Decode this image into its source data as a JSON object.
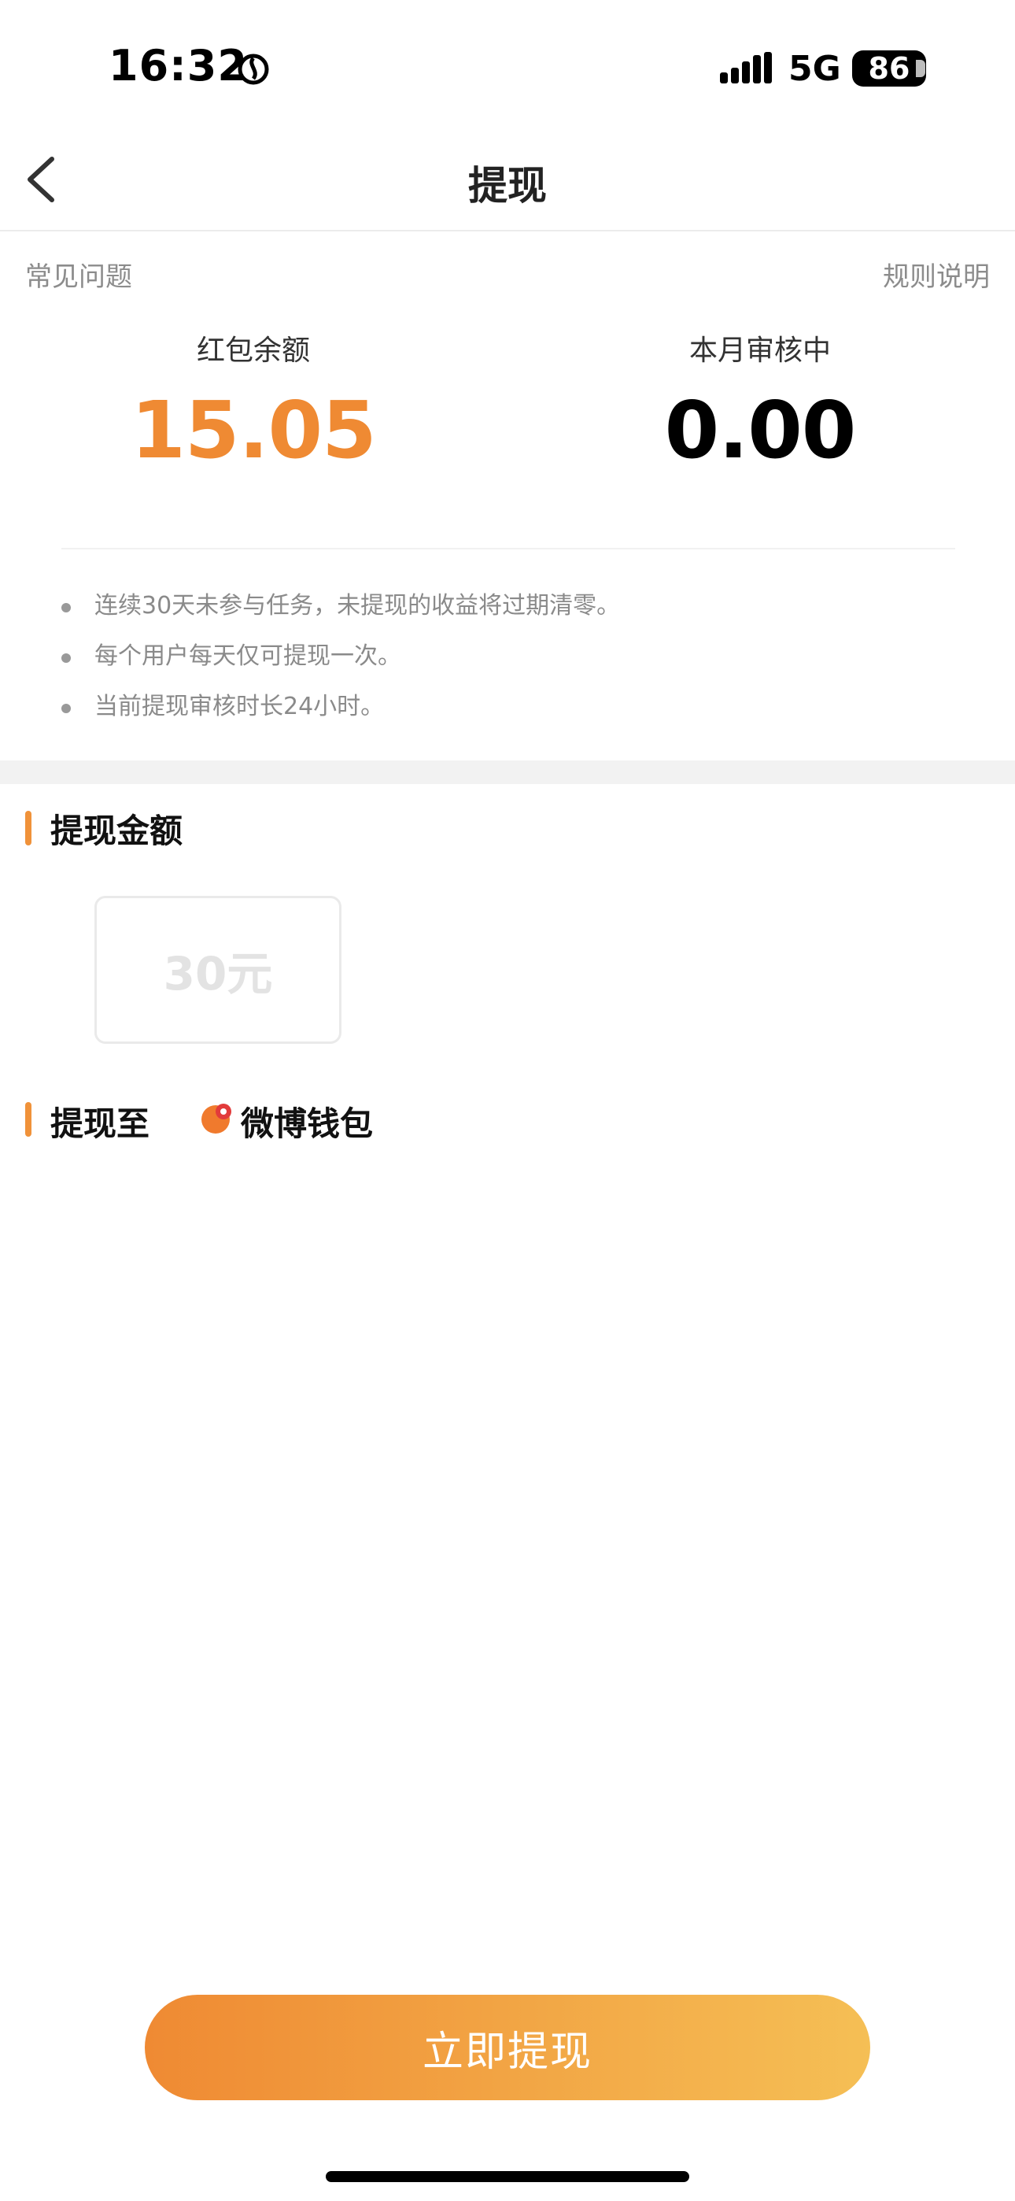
{
  "status_bar": {
    "time": "16:32",
    "network": "5G",
    "battery": "86",
    "icons": [
      "moon-icon",
      "signal-icon",
      "battery-icon"
    ]
  },
  "nav": {
    "title": "提现",
    "back_icon": "chevron-left-icon"
  },
  "links": {
    "faq": "常见问题",
    "rules": "规则说明"
  },
  "stats": {
    "balance_label": "红包余额",
    "balance_value": "15.05",
    "reviewing_label": "本月审核中",
    "reviewing_value": "0.00"
  },
  "tips": [
    "连续30天未参与任务，未提现的收益将过期清零。",
    "每个用户每天仅可提现一次。",
    "当前提现审核时长24小时。"
  ],
  "amount_section": {
    "title": "提现金额",
    "options": [
      "30元"
    ]
  },
  "destination_section": {
    "title": "提现至",
    "wallet": "微博钱包",
    "wallet_icon": "weibo-wallet-icon"
  },
  "cta": {
    "label": "立即提现"
  },
  "colors": {
    "accent": "#f0923a",
    "balance": "#ef8a33",
    "cta_start": "#ef8a33",
    "cta_end": "#f5bf55"
  }
}
